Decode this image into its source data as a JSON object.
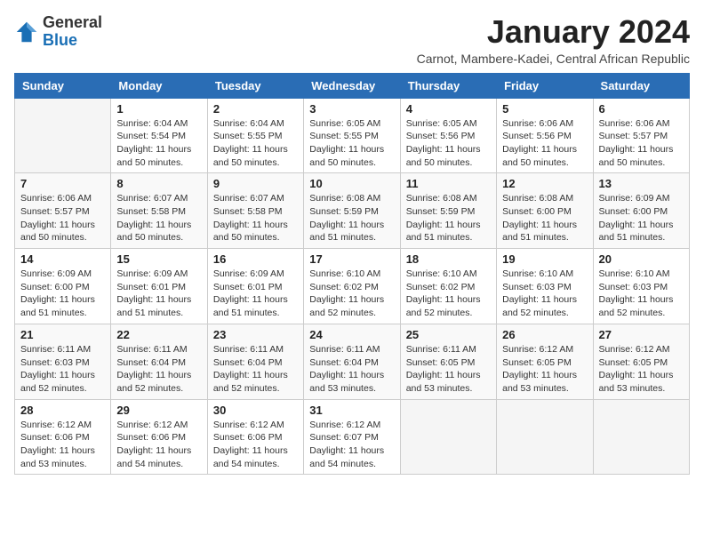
{
  "logo": {
    "general": "General",
    "blue": "Blue"
  },
  "header": {
    "title": "January 2024",
    "subtitle": "Carnot, Mambere-Kadei, Central African Republic"
  },
  "weekdays": [
    "Sunday",
    "Monday",
    "Tuesday",
    "Wednesday",
    "Thursday",
    "Friday",
    "Saturday"
  ],
  "weeks": [
    [
      {
        "day": "",
        "info": ""
      },
      {
        "day": "1",
        "info": "Sunrise: 6:04 AM\nSunset: 5:54 PM\nDaylight: 11 hours\nand 50 minutes."
      },
      {
        "day": "2",
        "info": "Sunrise: 6:04 AM\nSunset: 5:55 PM\nDaylight: 11 hours\nand 50 minutes."
      },
      {
        "day": "3",
        "info": "Sunrise: 6:05 AM\nSunset: 5:55 PM\nDaylight: 11 hours\nand 50 minutes."
      },
      {
        "day": "4",
        "info": "Sunrise: 6:05 AM\nSunset: 5:56 PM\nDaylight: 11 hours\nand 50 minutes."
      },
      {
        "day": "5",
        "info": "Sunrise: 6:06 AM\nSunset: 5:56 PM\nDaylight: 11 hours\nand 50 minutes."
      },
      {
        "day": "6",
        "info": "Sunrise: 6:06 AM\nSunset: 5:57 PM\nDaylight: 11 hours\nand 50 minutes."
      }
    ],
    [
      {
        "day": "7",
        "info": "Sunrise: 6:06 AM\nSunset: 5:57 PM\nDaylight: 11 hours\nand 50 minutes."
      },
      {
        "day": "8",
        "info": "Sunrise: 6:07 AM\nSunset: 5:58 PM\nDaylight: 11 hours\nand 50 minutes."
      },
      {
        "day": "9",
        "info": "Sunrise: 6:07 AM\nSunset: 5:58 PM\nDaylight: 11 hours\nand 50 minutes."
      },
      {
        "day": "10",
        "info": "Sunrise: 6:08 AM\nSunset: 5:59 PM\nDaylight: 11 hours\nand 51 minutes."
      },
      {
        "day": "11",
        "info": "Sunrise: 6:08 AM\nSunset: 5:59 PM\nDaylight: 11 hours\nand 51 minutes."
      },
      {
        "day": "12",
        "info": "Sunrise: 6:08 AM\nSunset: 6:00 PM\nDaylight: 11 hours\nand 51 minutes."
      },
      {
        "day": "13",
        "info": "Sunrise: 6:09 AM\nSunset: 6:00 PM\nDaylight: 11 hours\nand 51 minutes."
      }
    ],
    [
      {
        "day": "14",
        "info": "Sunrise: 6:09 AM\nSunset: 6:00 PM\nDaylight: 11 hours\nand 51 minutes."
      },
      {
        "day": "15",
        "info": "Sunrise: 6:09 AM\nSunset: 6:01 PM\nDaylight: 11 hours\nand 51 minutes."
      },
      {
        "day": "16",
        "info": "Sunrise: 6:09 AM\nSunset: 6:01 PM\nDaylight: 11 hours\nand 51 minutes."
      },
      {
        "day": "17",
        "info": "Sunrise: 6:10 AM\nSunset: 6:02 PM\nDaylight: 11 hours\nand 52 minutes."
      },
      {
        "day": "18",
        "info": "Sunrise: 6:10 AM\nSunset: 6:02 PM\nDaylight: 11 hours\nand 52 minutes."
      },
      {
        "day": "19",
        "info": "Sunrise: 6:10 AM\nSunset: 6:03 PM\nDaylight: 11 hours\nand 52 minutes."
      },
      {
        "day": "20",
        "info": "Sunrise: 6:10 AM\nSunset: 6:03 PM\nDaylight: 11 hours\nand 52 minutes."
      }
    ],
    [
      {
        "day": "21",
        "info": "Sunrise: 6:11 AM\nSunset: 6:03 PM\nDaylight: 11 hours\nand 52 minutes."
      },
      {
        "day": "22",
        "info": "Sunrise: 6:11 AM\nSunset: 6:04 PM\nDaylight: 11 hours\nand 52 minutes."
      },
      {
        "day": "23",
        "info": "Sunrise: 6:11 AM\nSunset: 6:04 PM\nDaylight: 11 hours\nand 52 minutes."
      },
      {
        "day": "24",
        "info": "Sunrise: 6:11 AM\nSunset: 6:04 PM\nDaylight: 11 hours\nand 53 minutes."
      },
      {
        "day": "25",
        "info": "Sunrise: 6:11 AM\nSunset: 6:05 PM\nDaylight: 11 hours\nand 53 minutes."
      },
      {
        "day": "26",
        "info": "Sunrise: 6:12 AM\nSunset: 6:05 PM\nDaylight: 11 hours\nand 53 minutes."
      },
      {
        "day": "27",
        "info": "Sunrise: 6:12 AM\nSunset: 6:05 PM\nDaylight: 11 hours\nand 53 minutes."
      }
    ],
    [
      {
        "day": "28",
        "info": "Sunrise: 6:12 AM\nSunset: 6:06 PM\nDaylight: 11 hours\nand 53 minutes."
      },
      {
        "day": "29",
        "info": "Sunrise: 6:12 AM\nSunset: 6:06 PM\nDaylight: 11 hours\nand 54 minutes."
      },
      {
        "day": "30",
        "info": "Sunrise: 6:12 AM\nSunset: 6:06 PM\nDaylight: 11 hours\nand 54 minutes."
      },
      {
        "day": "31",
        "info": "Sunrise: 6:12 AM\nSunset: 6:07 PM\nDaylight: 11 hours\nand 54 minutes."
      },
      {
        "day": "",
        "info": ""
      },
      {
        "day": "",
        "info": ""
      },
      {
        "day": "",
        "info": ""
      }
    ]
  ]
}
